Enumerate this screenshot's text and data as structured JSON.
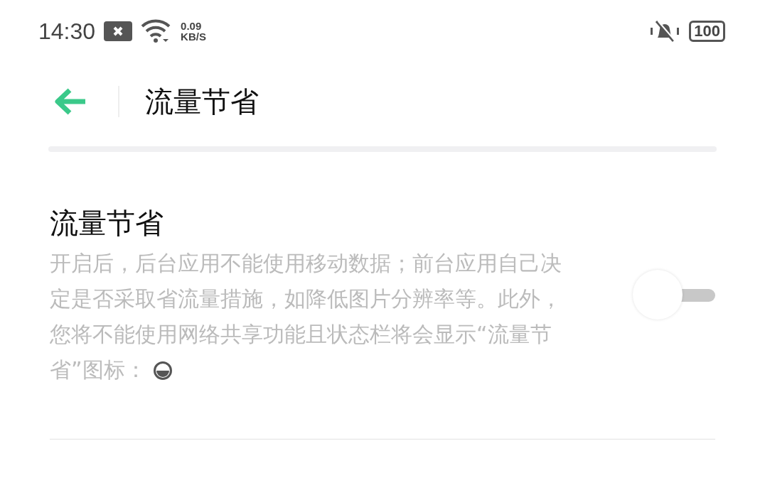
{
  "status_bar": {
    "time": "14:30",
    "speed_value": "0.09",
    "speed_unit": "KB/S",
    "battery": "100"
  },
  "header": {
    "title": "流量节省"
  },
  "setting": {
    "title": "流量节省",
    "description": "开启后，后台应用不能使用移动数据；前台应用自己决定是否采取省流量措施，如降低图片分辨率等。此外，您将不能使用网络共享功能且状态栏将会显示“流量节省”图标：",
    "on": false
  }
}
